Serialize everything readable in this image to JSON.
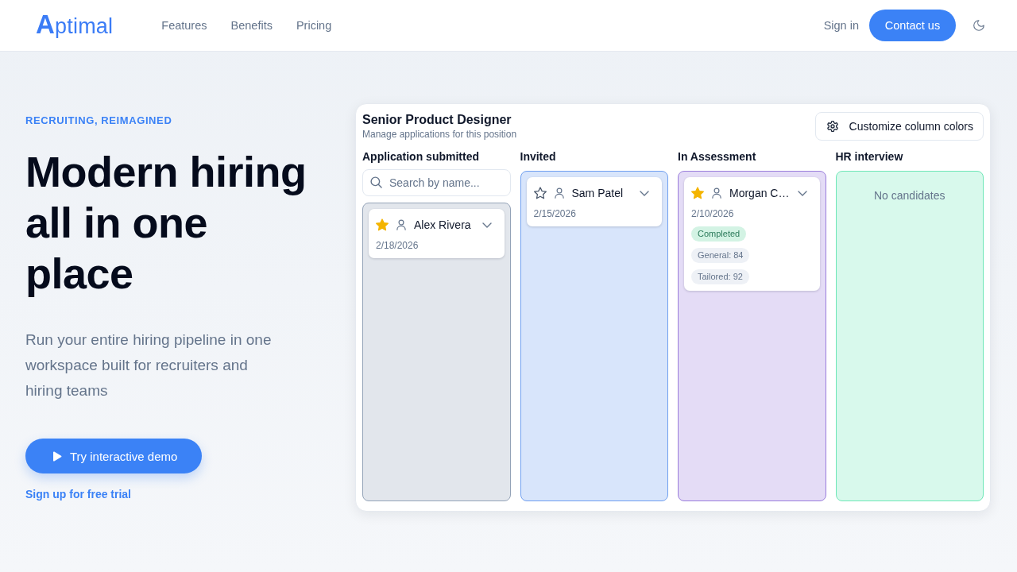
{
  "header": {
    "logo": "Aptimal",
    "nav": [
      "Features",
      "Benefits",
      "Pricing"
    ],
    "sign_in": "Sign in",
    "contact_button": "Contact us"
  },
  "hero": {
    "eyebrow": "RECRUITING, REIMAGINED",
    "title": "Modern hiring all in one place",
    "text": "Run your entire hiring pipeline in one workspace built for recruiters and hiring teams",
    "demo_button": "Try interactive demo",
    "trial_link": "Sign up for free trial"
  },
  "board": {
    "title": "Senior Product Designer",
    "subtitle": "Manage applications for this position",
    "customize_button": "Customize column colors",
    "columns": [
      {
        "name": "Application submitted",
        "color": "#94a3b8",
        "search": {
          "placeholder": "Search by name..."
        },
        "cards": [
          {
            "name": "Alex Rivera",
            "starred": true,
            "date": "2/18/2026"
          }
        ]
      },
      {
        "name": "Invited",
        "color": "#6f9ff0",
        "cards": [
          {
            "name": "Sam Patel",
            "starred": false,
            "date": "2/15/2026"
          }
        ]
      },
      {
        "name": "In Assessment",
        "color": "#9a7ddc",
        "cards": [
          {
            "name": "Morgan C…",
            "starred": true,
            "date": "2/10/2026",
            "badges": [
              {
                "kind": "status",
                "text": "Completed"
              },
              {
                "kind": "score",
                "text": "General: 84"
              },
              {
                "kind": "score",
                "text": "Tailored: 92"
              }
            ]
          }
        ]
      },
      {
        "name": "HR interview",
        "color": "#6ee7b7",
        "empty_text": "No candidates"
      }
    ]
  }
}
